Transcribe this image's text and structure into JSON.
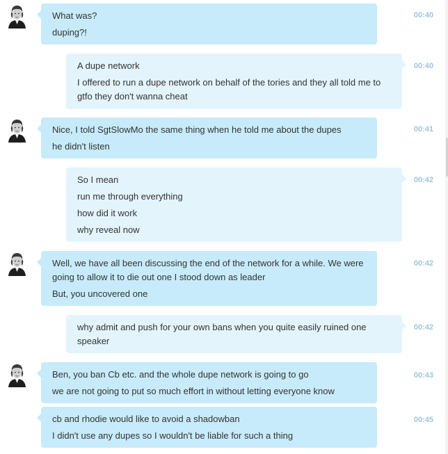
{
  "messages": [
    {
      "lines": [
        "What was?",
        "duping?!"
      ],
      "time": "00:40"
    },
    {
      "lines": [
        "A dupe network",
        "I offered to run a dupe network on behalf of the tories and they all told me to gtfo they don't wanna cheat"
      ],
      "time": "00:40"
    },
    {
      "lines": [
        "Nice, I told SgtSlowMo the same thing when he told me about the dupes",
        "he didn't listen"
      ],
      "time": "00:41"
    },
    {
      "lines": [
        "So I mean",
        "run me through everything",
        "how did it work",
        "why reveal now"
      ],
      "time": "00:42"
    },
    {
      "lines": [
        "Well, we have all been discussing the end of the network for a while. We were going to allow it to die out one I stood down as leader",
        "But, you uncovered one"
      ],
      "time": "00:42"
    },
    {
      "lines": [
        "why admit and push for your own bans when you quite easily ruined one speaker"
      ],
      "time": "00:42"
    },
    {
      "lines": [
        "Ben, you ban Cb etc. and the whole dupe network is going to go",
        "we are not going to put so much effort in without letting everyone know"
      ],
      "time": "00:43"
    },
    {
      "lines": [
        "cb and rhodie would like to avoid a shadowban",
        "I didn't use any dupes so I wouldn't be liable for such a thing"
      ],
      "time": "00:45"
    }
  ],
  "colors": {
    "incoming_bubble": "#c7ebfa",
    "outgoing_bubble": "#e3f4fc",
    "timestamp": "#9fc6da"
  },
  "icons": {
    "avatar": "portrait-avatar-icon"
  }
}
